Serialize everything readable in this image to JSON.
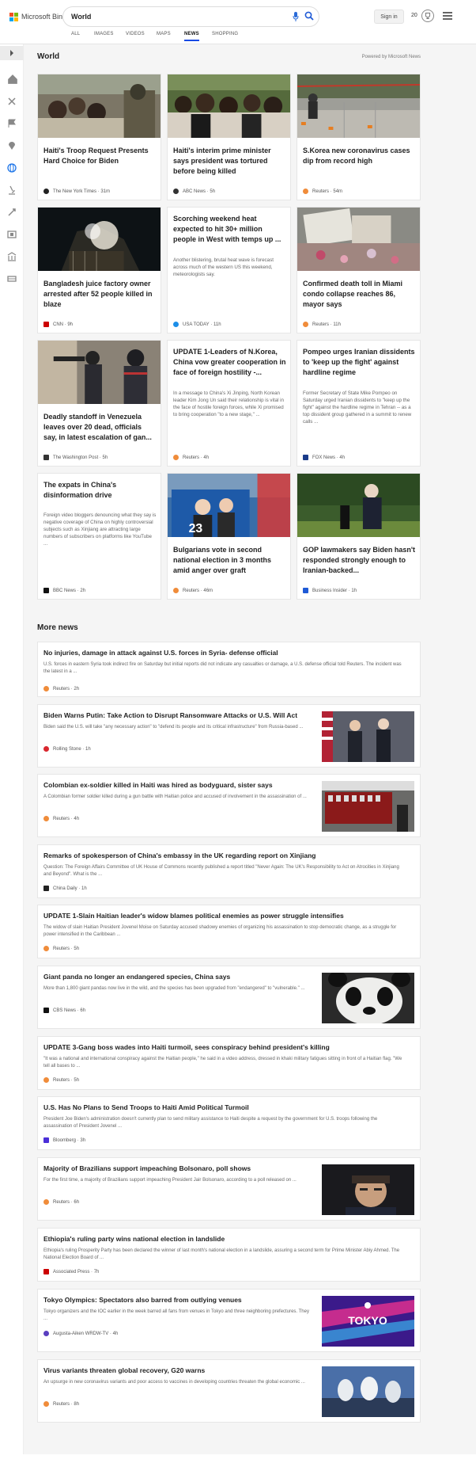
{
  "header": {
    "logo_text": "Microsoft Bing",
    "search_value": "World",
    "signin_label": "Sign in",
    "points": "20",
    "logo_colors": [
      "#f25022",
      "#7fba00",
      "#00a4ef",
      "#ffb900"
    ]
  },
  "tabs": [
    {
      "label": "ALL"
    },
    {
      "label": "IMAGES"
    },
    {
      "label": "VIDEOS"
    },
    {
      "label": "MAPS"
    },
    {
      "label": "NEWS"
    },
    {
      "label": "SHOPPING"
    }
  ],
  "section": {
    "title": "World",
    "powered": "Powered by Microsoft News"
  },
  "cards": [
    {
      "title": "Haiti's Troop Request Presents Hard Choice for Biden",
      "source": "The New York Times",
      "age": "31m"
    },
    {
      "title": "Haiti's interim prime minister says president was tortured before being killed",
      "source": "ABC News",
      "age": "5h"
    },
    {
      "title": "S.Korea new coronavirus cases dip from record high",
      "source": "Reuters",
      "age": "54m"
    },
    {
      "title": "Bangladesh juice factory owner arrested after 52 people killed in blaze",
      "source": "CNN",
      "age": "9h"
    },
    {
      "title": "Scorching weekend heat expected to hit 30+ million people in West with temps up ...",
      "snippet": "Another blistering, brutal heat wave is forecast across much of the western US this weekend, meteorologists say.",
      "source": "USA TODAY",
      "age": "11h"
    },
    {
      "title": "Confirmed death toll in Miami condo collapse reaches 86, mayor says",
      "source": "Reuters",
      "age": "11h"
    },
    {
      "title": "Deadly standoff in Venezuela leaves over 20 dead, officials say, in latest escalation of gan...",
      "source": "The Washington Post",
      "age": "5h"
    },
    {
      "title": "UPDATE 1-Leaders of N.Korea, China vow greater cooperation in face of foreign hostility -...",
      "snippet": "In a message to China's Xi Jinping, North Korean leader Kim Jong Un said their relationship is vital in the face of hostile foreign forces, while Xi promised to bring cooperation \"to a new stage,\" ...",
      "source": "Reuters",
      "age": "4h"
    },
    {
      "title": "Pompeo urges Iranian dissidents to 'keep up the fight' against hardline regime",
      "snippet": "Former Secretary of State Mike Pompeo on Saturday urged Iranian dissidents to \"keep up the fight\" against the hardline regime in Tehran -- as a top dissident group gathered in a summit to renew calls ...",
      "source": "FOX News",
      "age": "4h"
    },
    {
      "title": "The expats in China's disinformation drive",
      "snippet": "Foreign video bloggers denouncing what they say is negative coverage of China on highly controversial subjects such as Xinjiang are attracting large numbers of subscribers on platforms like YouTube ...",
      "source": "BBC News",
      "age": "2h"
    },
    {
      "title": "Bulgarians vote in second national election in 3 months amid anger over graft",
      "source": "Reuters",
      "age": "46m",
      "image_text": "23"
    },
    {
      "title": "GOP lawmakers say Biden hasn't responded strongly enough to Iranian-backed...",
      "source": "Business Insider",
      "age": "1h"
    }
  ],
  "more": {
    "title": "More news",
    "items": [
      {
        "title": "No injuries, damage in attack against U.S. forces in Syria- defense official",
        "snippet": "U.S. forces in eastern Syria took indirect fire on Saturday but initial reports did not indicate any casualties or damage, a U.S. defense official told Reuters. The incident was the latest in a ...",
        "source": "Reuters",
        "age": "2h"
      },
      {
        "title": "Biden Warns Putin: Take Action to Disrupt Ransomware Attacks or U.S. Will Act",
        "snippet": "Biden said the U.S. will take \"any necessary action\" to \"defend its people and its critical infrastructure\" from Russia-based ...",
        "source": "Rolling Stone",
        "age": "1h"
      },
      {
        "title": "Colombian ex-soldier killed in Haiti was hired as bodyguard, sister says",
        "snippet": "A Colombian former soldier killed during a gun battle with Haitian police and accused of involvement in the assassination of ...",
        "source": "Reuters",
        "age": "4h"
      },
      {
        "title": "Remarks of spokesperson of China's embassy in the UK regarding report on Xinjiang",
        "snippet": "Question: The Foreign Affairs Committee of UK House of Commons recently published a report titled \"Never Again: The UK's Responsibility to Act on Atrocities in Xinjiang and Beyond\". What is the ...",
        "source": "China Daily",
        "age": "1h"
      },
      {
        "title": "UPDATE 1-Slain Haitian leader's widow blames political enemies as power struggle intensifies",
        "snippet": "The widow of slain Haitian President Jovenel Moise on Saturday accused shadowy enemies of organizing his assassination to stop democratic change, as a struggle for power intensified in the Caribbean ...",
        "source": "Reuters",
        "age": "5h"
      },
      {
        "title": "Giant panda no longer an endangered species, China says",
        "snippet": "More than 1,800 giant pandas now live in the wild, and the species has been upgraded from \"endangered\" to \"vulnerable.\" ...",
        "source": "CBS News",
        "age": "6h"
      },
      {
        "title": "UPDATE 3-Gang boss wades into Haiti turmoil, sees conspiracy behind president's killing",
        "snippet": "\"It was a national and international conspiracy against the Haitian people,\" he said in a video address, dressed in khaki military fatigues sitting in front of a Haitian flag. \"We tell all bases to ...",
        "source": "Reuters",
        "age": "5h"
      },
      {
        "title": "U.S. Has No Plans to Send Troops to Haiti Amid Political Turmoil",
        "snippet": "President Joe Biden's administration doesn't currently plan to send military assistance to Haiti despite a request by the government for U.S. troops following the assassination of President Jovenel ...",
        "source": "Bloomberg",
        "age": "3h"
      },
      {
        "title": "Majority of Brazilians support impeaching Bolsonaro, poll shows",
        "snippet": "For the first time, a majority of Brazilians support impeaching President Jair Bolsonaro, according to a poll released on ...",
        "source": "Reuters",
        "age": "6h"
      },
      {
        "title": "Ethiopia's ruling party wins national election in landslide",
        "snippet": "Ethiopia's ruling Prosperity Party has been declared the winner of last month's national election in a landslide, assuring a second term for Prime Minister Abiy Ahmed. The National Election Board of ...",
        "source": "Associated Press",
        "age": "7h"
      },
      {
        "title": "Tokyo Olympics: Spectators also barred from outlying venues",
        "snippet": "Tokyo organizers and the IOC earlier in the week barred all fans from venues in Tokyo and three neighboring prefectures. They ...",
        "source": "Augusta-Aiken WRDW-TV",
        "age": "4h",
        "image_text": "TOKYO"
      },
      {
        "title": "Virus variants threaten global recovery, G20 warns",
        "snippet": "An upsurge in new coronavirus variants and poor access to vaccines in developing countries threaten the global economic ...",
        "source": "Reuters",
        "age": "8h"
      }
    ]
  }
}
